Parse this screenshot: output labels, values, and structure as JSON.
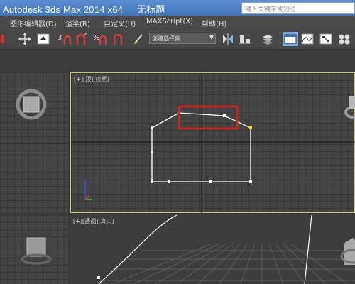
{
  "titlebar": {
    "app_name": "Autodesk 3ds Max",
    "version": "2014 x64",
    "doc_name": "无标题",
    "search_placeholder": "键入关键字或短语"
  },
  "menubar": {
    "items": [
      "图形编辑器(D)",
      "渲染(R)",
      "自定义(U)",
      "MAXScript(X)",
      "帮助(H)"
    ]
  },
  "toolbar": {
    "snap_label": "3",
    "percent_snap_label": "%",
    "selection_set_placeholder": "创建选择集",
    "icons": [
      "move-icon",
      "rotate-icon",
      "snap-toggle-icon",
      "angle-snap-icon",
      "percent-snap-icon",
      "spinner-snap-icon",
      "edit-named-selection-icon",
      "mirror-icon",
      "align-icon",
      "layer-manager-icon",
      "graphite-ribbon-icon",
      "curve-editor-icon",
      "schematic-view-icon",
      "material-editor-icon"
    ]
  },
  "viewports": {
    "top": {
      "plus": "[+]",
      "view": "[顶]",
      "shading": "[线框]"
    },
    "perspective": {
      "plus": "[+]",
      "view": "[透视]",
      "shading": "[真实]"
    }
  },
  "colors": {
    "titlebar": "#4a7fc4",
    "active_border": "#c8c86a",
    "highlight_box": "#e01b1b",
    "spline": "#ffffff",
    "selected_vertex": "#ffd700"
  }
}
